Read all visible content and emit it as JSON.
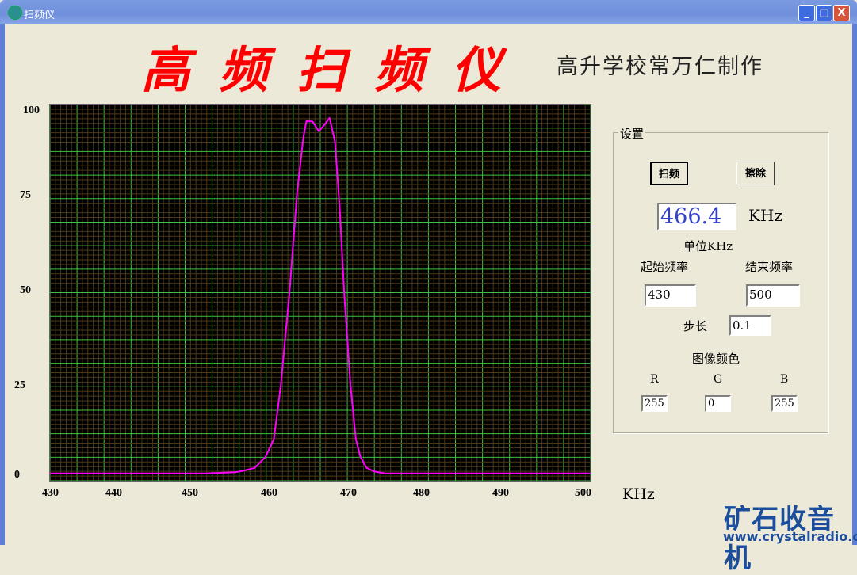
{
  "window": {
    "title": "扫频仪",
    "minimize": "_",
    "maximize": "□",
    "close": "X"
  },
  "header": {
    "title": "高频扫频仪",
    "subtitle": "高升学校常万仁制作"
  },
  "settings": {
    "group_label": "设置",
    "sweep_button": "扫频",
    "erase_button": "擦除",
    "frequency_display": "466.4",
    "frequency_unit": "KHz",
    "unit_note": "单位KHz",
    "start_label": "起始频率",
    "start_value": "430",
    "end_label": "结束频率",
    "end_value": "500",
    "step_label": "步长",
    "step_value": "0.1",
    "color_label": "图像颜色",
    "r_label": "R",
    "r_value": "255",
    "g_label": "G",
    "g_value": "0",
    "b_label": "B",
    "b_value": "255"
  },
  "watermark": {
    "logo": "矿石收音机",
    "url": "www.crystalradio.cn"
  },
  "chart_data": {
    "type": "line",
    "xlabel": "KHz",
    "xlim": [
      430,
      500
    ],
    "ylim": [
      0,
      100
    ],
    "x_ticks": [
      "430",
      "440",
      "450",
      "460",
      "470",
      "480",
      "490",
      "500"
    ],
    "y_ticks": [
      "100",
      "75",
      "50",
      "25",
      "0"
    ],
    "grid": true,
    "background": "#000000",
    "grid_color": "#40c040",
    "line_color": "#ff00ff",
    "series": [
      {
        "x": [
          430,
          440,
          450,
          454,
          455,
          456.5,
          457.9,
          459,
          459.9,
          461,
          462,
          462.8,
          463.2,
          464,
          464.8,
          465.5,
          466.2,
          466.9,
          467.5,
          468.1,
          468.9,
          469.6,
          470.2,
          471,
          472,
          473.4,
          476,
          490,
          500
        ],
        "y": [
          0.5,
          0.5,
          0.5,
          0.8,
          1.2,
          2,
          5,
          10,
          25,
          50,
          78,
          93,
          97.6,
          97.5,
          94.8,
          96.5,
          98.5,
          92,
          74,
          50,
          25,
          10,
          5,
          2,
          1,
          0.5,
          0.5,
          0.5,
          0.5
        ]
      }
    ]
  }
}
